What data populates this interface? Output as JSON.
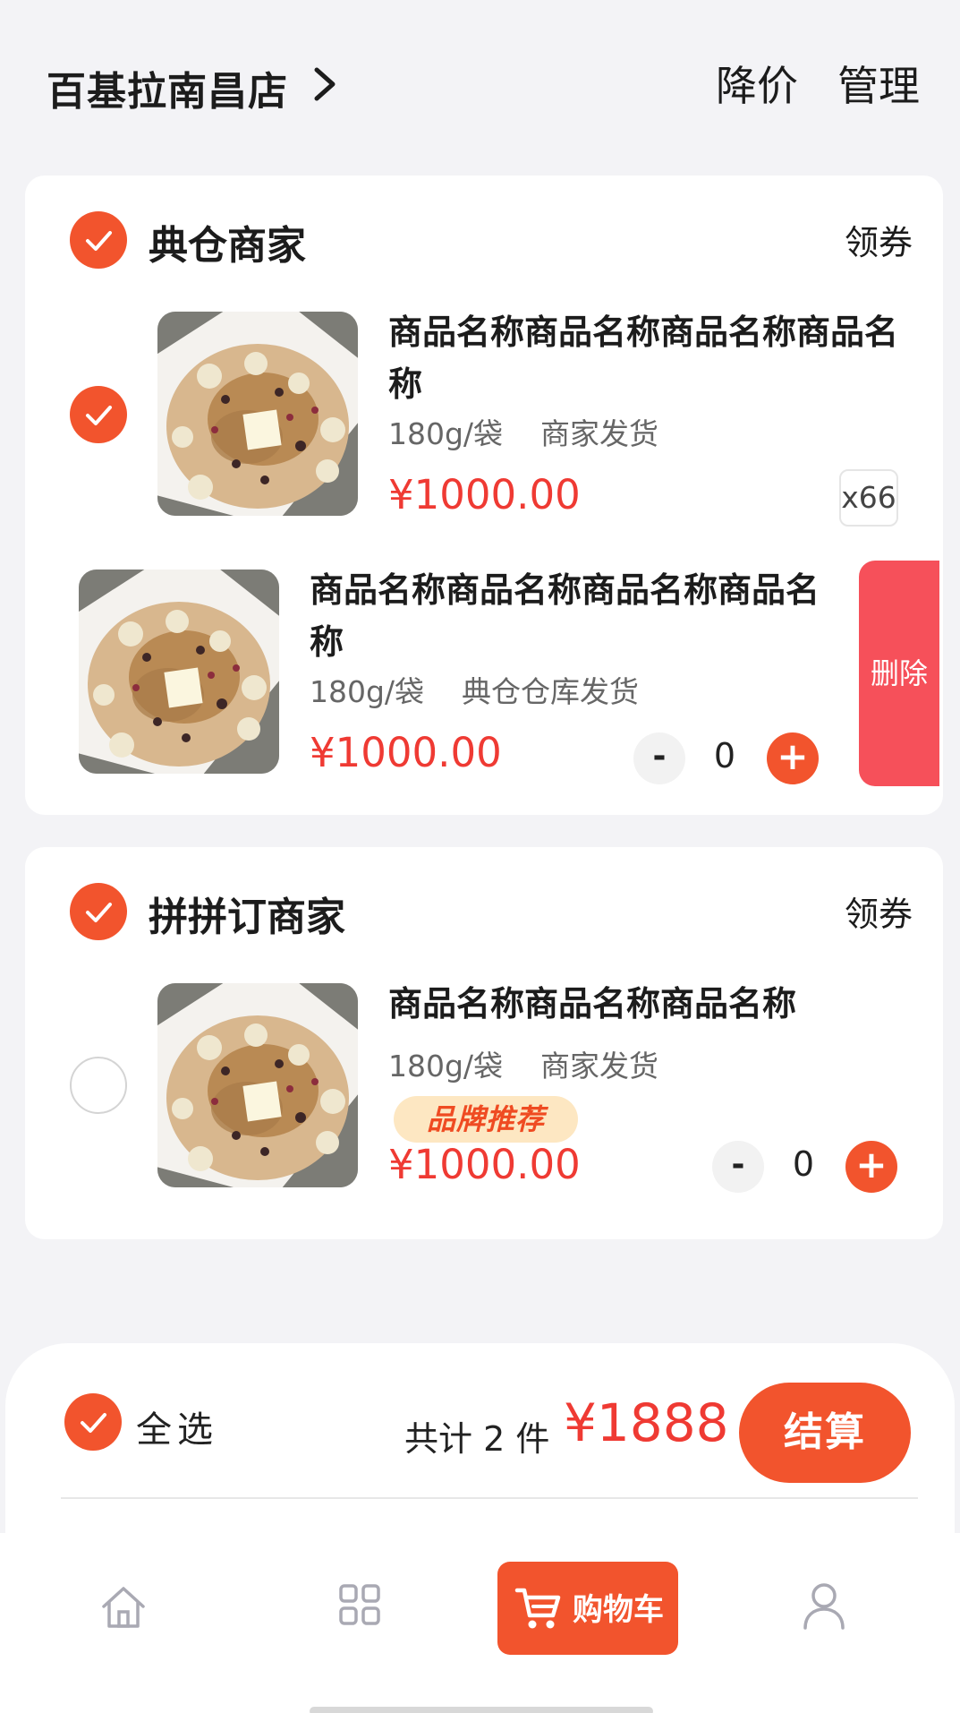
{
  "header": {
    "store_name": "百基拉南昌店",
    "price_drop_label": "降价",
    "manage_label": "管理"
  },
  "merchants": [
    {
      "name": "典仓商家",
      "coupon_label": "领券",
      "items": [
        {
          "name": "商品名称商品名称商品名称商品名称",
          "spec": "180g/袋    商家发货",
          "price": "¥1000.00",
          "qty_badge": "x66"
        },
        {
          "name": "商品名称商品名称商品名称商品名称",
          "spec": "180g/袋    典仓仓库发货",
          "price": "¥1000.00",
          "minus": "-",
          "qty": "0",
          "plus": "+",
          "delete_label": "删除"
        }
      ]
    },
    {
      "name": "拼拼订商家",
      "coupon_label": "领券",
      "items": [
        {
          "name": "商品名称商品名称商品名称",
          "spec": "180g/袋    商家发货",
          "badge": "品牌推荐",
          "price": "¥1000.00",
          "minus": "-",
          "qty": "0",
          "plus": "+"
        }
      ]
    }
  ],
  "footer": {
    "select_all_label": "全选",
    "total_count_label": "共计 2 件",
    "total_price": "¥1888",
    "checkout_label": "结算"
  },
  "tabbar": {
    "items": [
      {
        "icon": "home-icon"
      },
      {
        "icon": "grid-icon"
      },
      {
        "icon": "cart-icon",
        "label": "购物车",
        "active": true
      },
      {
        "icon": "user-icon"
      }
    ]
  },
  "colors": {
    "accent": "#f2542d",
    "price": "#ef3a33",
    "delete": "#f6505a",
    "background": "#f3f3f6"
  }
}
